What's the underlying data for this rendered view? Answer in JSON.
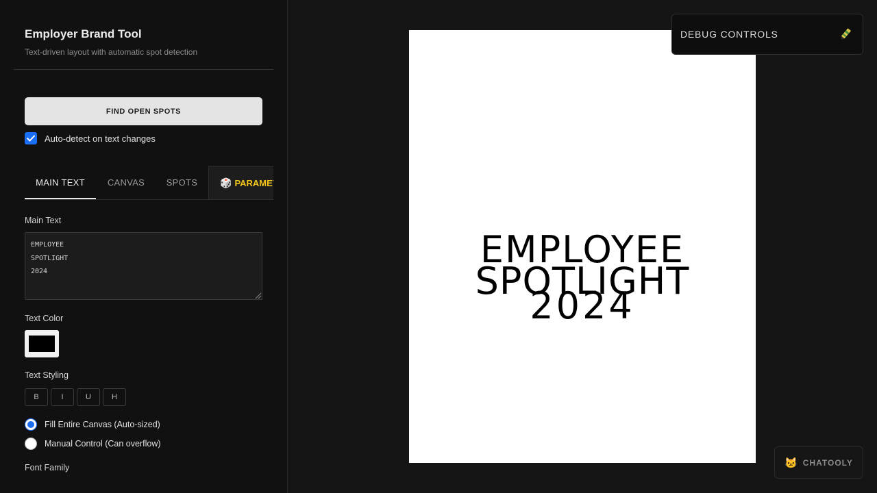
{
  "sidebar": {
    "title": "Employer Brand Tool",
    "subtitle": "Text-driven layout with automatic spot detection",
    "find_button": "FIND OPEN SPOTS",
    "auto_detect_label": "Auto-detect on text changes",
    "auto_detect_checked": true,
    "tabs": [
      {
        "label": "MAIN TEXT",
        "active": true
      },
      {
        "label": "CANVAS",
        "active": false
      },
      {
        "label": "SPOTS",
        "active": false
      },
      {
        "label": "PARAMETERS",
        "icon": "dice-icon",
        "active": false
      }
    ],
    "main_text_label": "Main Text",
    "main_text_value": "EMPLOYEE\nSPOTLIGHT\n2024",
    "text_color_label": "Text Color",
    "text_color": "#000000",
    "text_styling_label": "Text Styling",
    "style_buttons": [
      "B",
      "I",
      "U",
      "H"
    ],
    "size_modes": [
      {
        "label": "Fill Entire Canvas (Auto-sized)",
        "checked": true
      },
      {
        "label": "Manual Control (Can overflow)",
        "checked": false
      }
    ],
    "font_family_label": "Font Family"
  },
  "canvas": {
    "lines": [
      "EMPLOYEE",
      "SPOTLIGHT",
      "2024"
    ],
    "background": "#ffffff",
    "text_color": "#000000"
  },
  "debug": {
    "label": "DEBUG CONTROLS",
    "icon": "crayon-icon"
  },
  "chatooly": {
    "label": "CHATOOLY",
    "icon": "cat-icon"
  },
  "colors": {
    "accent": "#1a6ef5",
    "param_tab": "#f5c518"
  }
}
